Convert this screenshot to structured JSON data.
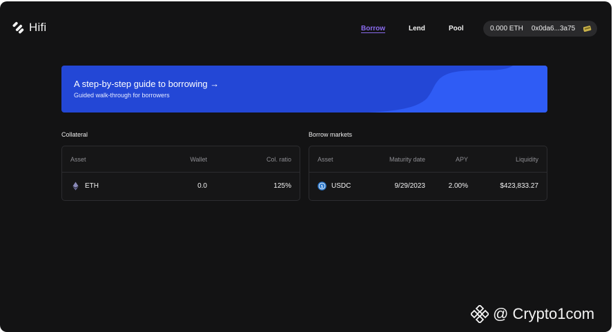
{
  "app": {
    "name": "Hifi"
  },
  "nav": {
    "items": [
      {
        "label": "Borrow",
        "active": true
      },
      {
        "label": "Lend",
        "active": false
      },
      {
        "label": "Pool",
        "active": false
      }
    ]
  },
  "wallet": {
    "balance": "0.000 ETH",
    "address": "0x0da6...3a75"
  },
  "banner": {
    "title": "A step-by-step guide to borrowing →",
    "subtitle": "Guided walk-through for borrowers"
  },
  "collateral": {
    "label": "Collateral",
    "columns": [
      "Asset",
      "Wallet",
      "Col. ratio"
    ],
    "rows": [
      {
        "asset": "ETH",
        "wallet": "0.0",
        "ratio": "125%"
      }
    ]
  },
  "borrow_markets": {
    "label": "Borrow markets",
    "columns": [
      "Asset",
      "Maturity date",
      "APY",
      "Liquidity"
    ],
    "rows": [
      {
        "asset": "USDC",
        "maturity": "9/29/2023",
        "apy": "2.00%",
        "liquidity": "$423,833.27"
      }
    ]
  },
  "watermark": {
    "text": "@ Crypto1com"
  },
  "colors": {
    "accent": "#8b6cf0",
    "banner": "#2347d6",
    "banner_wave": "#2f5cf5",
    "usdc": "#2775ca"
  }
}
